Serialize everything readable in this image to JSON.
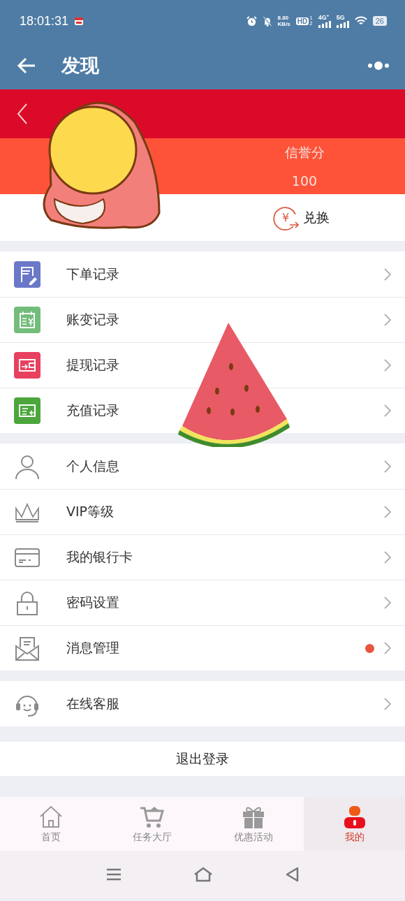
{
  "status_bar": {
    "time": "18:01:31",
    "speed_value": "8.80",
    "speed_unit": "KB/s",
    "hd": "HD",
    "hd_sims": [
      "1",
      "2"
    ],
    "network_a": "4G⁺",
    "network_b": "5G",
    "battery": "26"
  },
  "header": {
    "title": "发现"
  },
  "profile": {
    "credit_label": "信誉分",
    "credit_value": "100",
    "exchange_symbol": "¥",
    "exchange_label": "兑换"
  },
  "menu_groups": [
    {
      "items": [
        {
          "label": "下单记录",
          "kind": "order"
        },
        {
          "label": "账变记录",
          "kind": "ledger"
        },
        {
          "label": "提现记录",
          "kind": "withdraw"
        },
        {
          "label": "充值记录",
          "kind": "recharge"
        }
      ]
    },
    {
      "items": [
        {
          "label": "个人信息",
          "kind": "person"
        },
        {
          "label": "VIP等级",
          "kind": "crown"
        },
        {
          "label": "我的银行卡",
          "kind": "card"
        },
        {
          "label": "密码设置",
          "kind": "lock"
        },
        {
          "label": "消息管理",
          "kind": "mail",
          "unread": true
        }
      ]
    },
    {
      "items": [
        {
          "label": "在线客服",
          "kind": "support"
        }
      ]
    }
  ],
  "logout": {
    "label": "退出登录"
  },
  "tabs": [
    {
      "label": "首页",
      "kind": "home",
      "selected": false
    },
    {
      "label": "任务大厅",
      "kind": "cart",
      "selected": false
    },
    {
      "label": "优惠活动",
      "kind": "gift",
      "selected": false
    },
    {
      "label": "我的",
      "kind": "me",
      "selected": true
    }
  ]
}
